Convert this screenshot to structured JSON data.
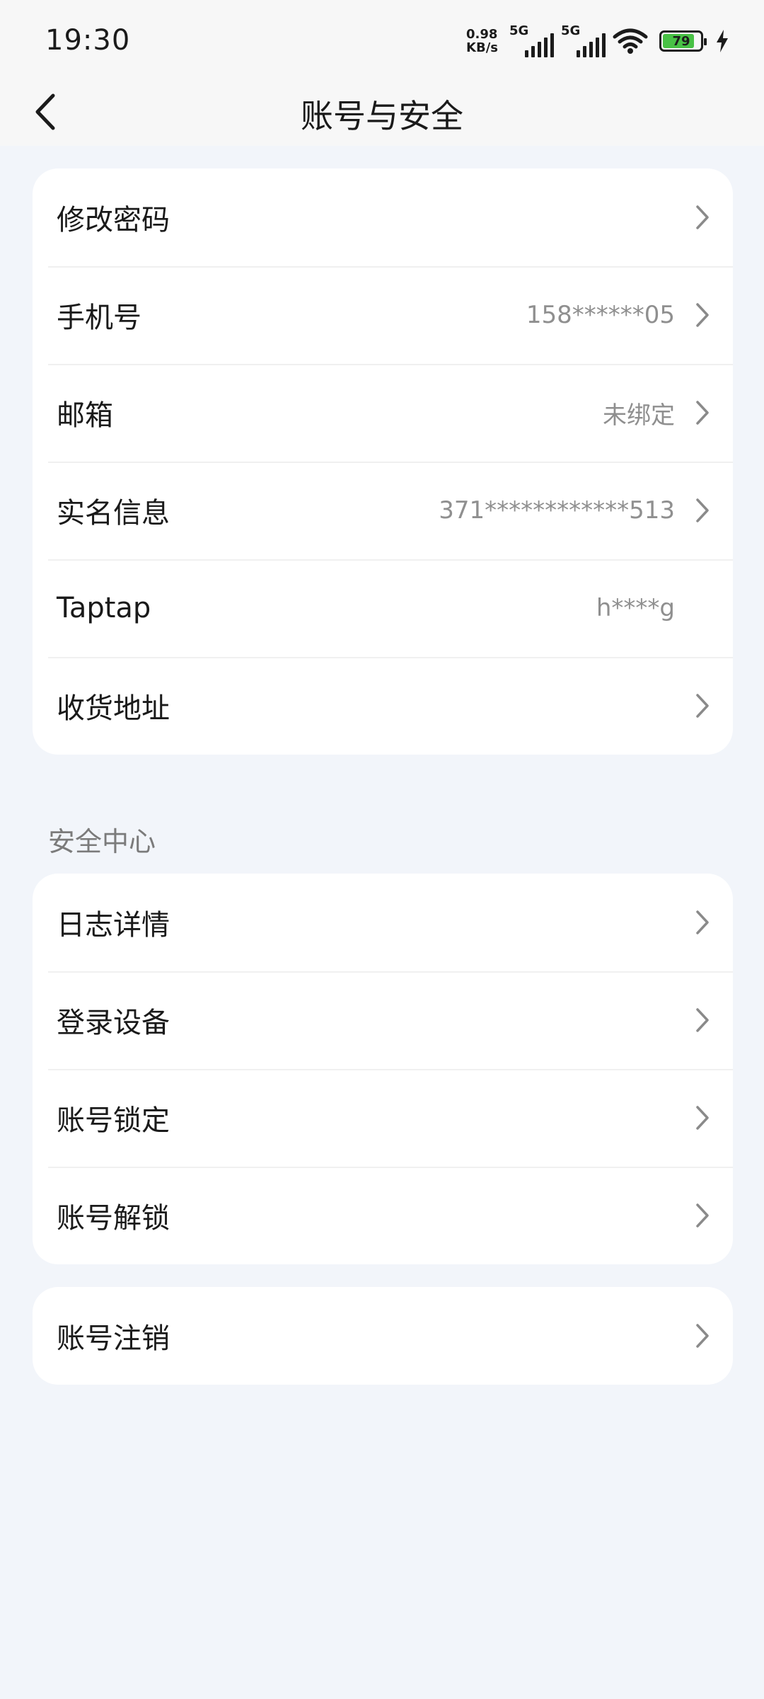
{
  "status_bar": {
    "time": "19:30",
    "net_speed_value": "0.98",
    "net_speed_unit": "KB/s",
    "network_1": "5G",
    "network_2": "5G",
    "battery_level": "79"
  },
  "header": {
    "title": "账号与安全"
  },
  "account_section": {
    "items": [
      {
        "label": "修改密码",
        "value": "",
        "chevron": true
      },
      {
        "label": "手机号",
        "value": "158******05",
        "chevron": true
      },
      {
        "label": "邮箱",
        "value": "未绑定",
        "chevron": true
      },
      {
        "label": "实名信息",
        "value": "371************513",
        "chevron": true
      },
      {
        "label": "Taptap",
        "value": "h****g",
        "chevron": false
      },
      {
        "label": "收货地址",
        "value": "",
        "chevron": true
      }
    ]
  },
  "security_section": {
    "title": "安全中心",
    "items": [
      {
        "label": "日志详情"
      },
      {
        "label": "登录设备"
      },
      {
        "label": "账号锁定"
      },
      {
        "label": "账号解锁"
      }
    ]
  },
  "cancel_section": {
    "items": [
      {
        "label": "账号注销"
      }
    ]
  },
  "icons": {
    "back": "chevron-left-icon",
    "row_arrow": "chevron-right-icon",
    "wifi": "wifi-icon",
    "battery": "battery-icon",
    "charging": "lightning-icon"
  }
}
